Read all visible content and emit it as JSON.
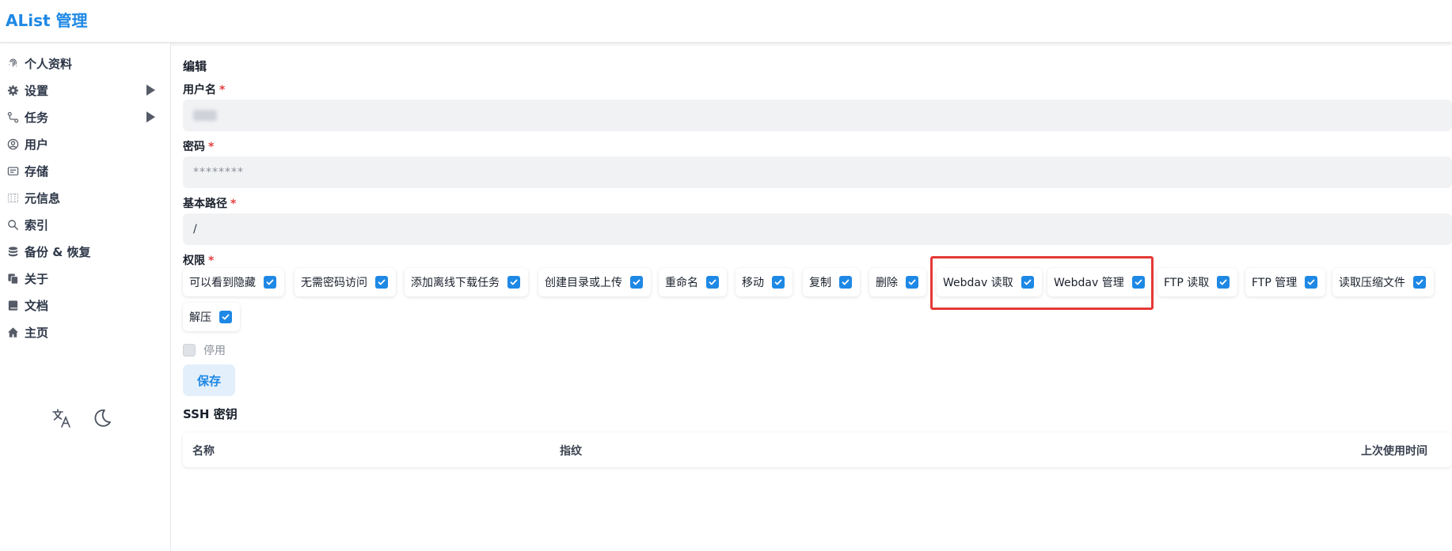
{
  "app": {
    "title": "AList 管理"
  },
  "sidebar": {
    "items": [
      {
        "label": "个人资料",
        "icon": "fingerprint-icon"
      },
      {
        "label": "设置",
        "icon": "gear-icon",
        "expandable": true
      },
      {
        "label": "任务",
        "icon": "route-icon",
        "expandable": true
      },
      {
        "label": "用户",
        "icon": "user-circle-icon"
      },
      {
        "label": "存储",
        "icon": "storage-icon"
      },
      {
        "label": "元信息",
        "icon": "metadata-icon"
      },
      {
        "label": "索引",
        "icon": "search-icon"
      },
      {
        "label": "备份 & 恢复",
        "icon": "database-icon"
      },
      {
        "label": "关于",
        "icon": "copy-icon"
      },
      {
        "label": "文档",
        "icon": "book-icon"
      },
      {
        "label": "主页",
        "icon": "home-icon"
      }
    ],
    "tools": [
      "translate-icon",
      "moon-icon"
    ]
  },
  "main": {
    "title": "编辑",
    "username": {
      "label": "用户名",
      "required": "*"
    },
    "password": {
      "label": "密码",
      "required": "*",
      "value": "********"
    },
    "base_path": {
      "label": "基本路径",
      "required": "*",
      "value": "/"
    },
    "permissions": {
      "label": "权限",
      "required": "*",
      "items": [
        {
          "label": "可以看到隐藏",
          "checked": true
        },
        {
          "label": "无需密码访问",
          "checked": true
        },
        {
          "label": "添加离线下载任务",
          "checked": true
        },
        {
          "label": "创建目录或上传",
          "checked": true
        },
        {
          "label": "重命名",
          "checked": true
        },
        {
          "label": "移动",
          "checked": true
        },
        {
          "label": "复制",
          "checked": true
        },
        {
          "label": "删除",
          "checked": true
        },
        {
          "label": "Webdav 读取",
          "checked": true
        },
        {
          "label": "Webdav 管理",
          "checked": true
        },
        {
          "label": "FTP 读取",
          "checked": true
        },
        {
          "label": "FTP 管理",
          "checked": true
        },
        {
          "label": "读取压缩文件",
          "checked": true
        },
        {
          "label": "解压",
          "checked": true
        }
      ]
    },
    "disabled": {
      "label": "停用",
      "checked": false
    },
    "save_label": "保存",
    "ssh": {
      "title": "SSH 密钥",
      "columns": [
        "名称",
        "指纹",
        "上次使用时间"
      ]
    }
  },
  "colors": {
    "accent": "#1e88e5",
    "highlight": "#e53935",
    "required": "#e53e3e"
  }
}
